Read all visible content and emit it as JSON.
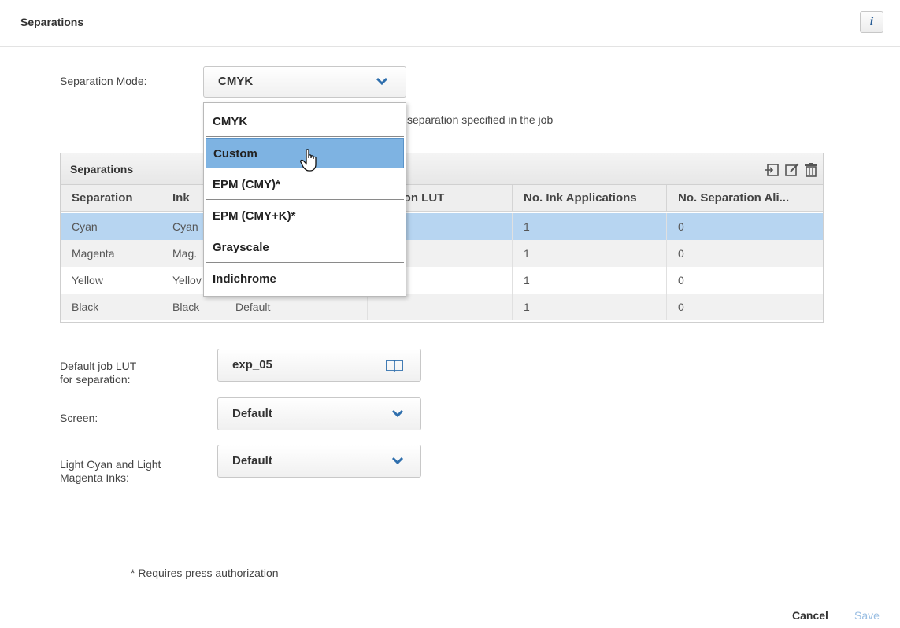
{
  "header": {
    "title": "Separations",
    "info_label": "i"
  },
  "form": {
    "separation_mode_label": "Separation Mode:",
    "separation_mode_value": "CMYK",
    "partial_text": "separation specified in the job",
    "default_lut_label": "Default job LUT\nfor separation:",
    "default_lut_value": "exp_05",
    "screen_label": "Screen:",
    "screen_value": "Default",
    "light_inks_label": "Light Cyan and Light\nMagenta Inks:",
    "light_inks_value": "Default"
  },
  "dropdown": {
    "options": [
      "CMYK",
      "Custom",
      "EPM (CMY)*",
      "EPM (CMY+K)*",
      "Grayscale",
      "Indichrome"
    ],
    "highlighted": "Custom"
  },
  "table": {
    "title": "Separations",
    "columns": [
      "Separation",
      "Ink",
      "",
      "aration LUT",
      "No. Ink Applications",
      "No. Separation Ali..."
    ],
    "rows": [
      [
        "Cyan",
        "Cyan",
        "",
        "",
        "1",
        "0"
      ],
      [
        "Magenta",
        "Mag.",
        "",
        "",
        "1",
        "0"
      ],
      [
        "Yellow",
        "Yellov",
        "",
        "",
        "1",
        "0"
      ],
      [
        "Black",
        "Black",
        "Default",
        "",
        "1",
        "0"
      ]
    ]
  },
  "footer": {
    "note": "* Requires press authorization",
    "cancel_label": "Cancel",
    "save_label": "Save"
  },
  "colors": {
    "selected_row": "#b7d5f1",
    "selected_option": "#7eb3e2",
    "accent": "#2f6fad"
  }
}
